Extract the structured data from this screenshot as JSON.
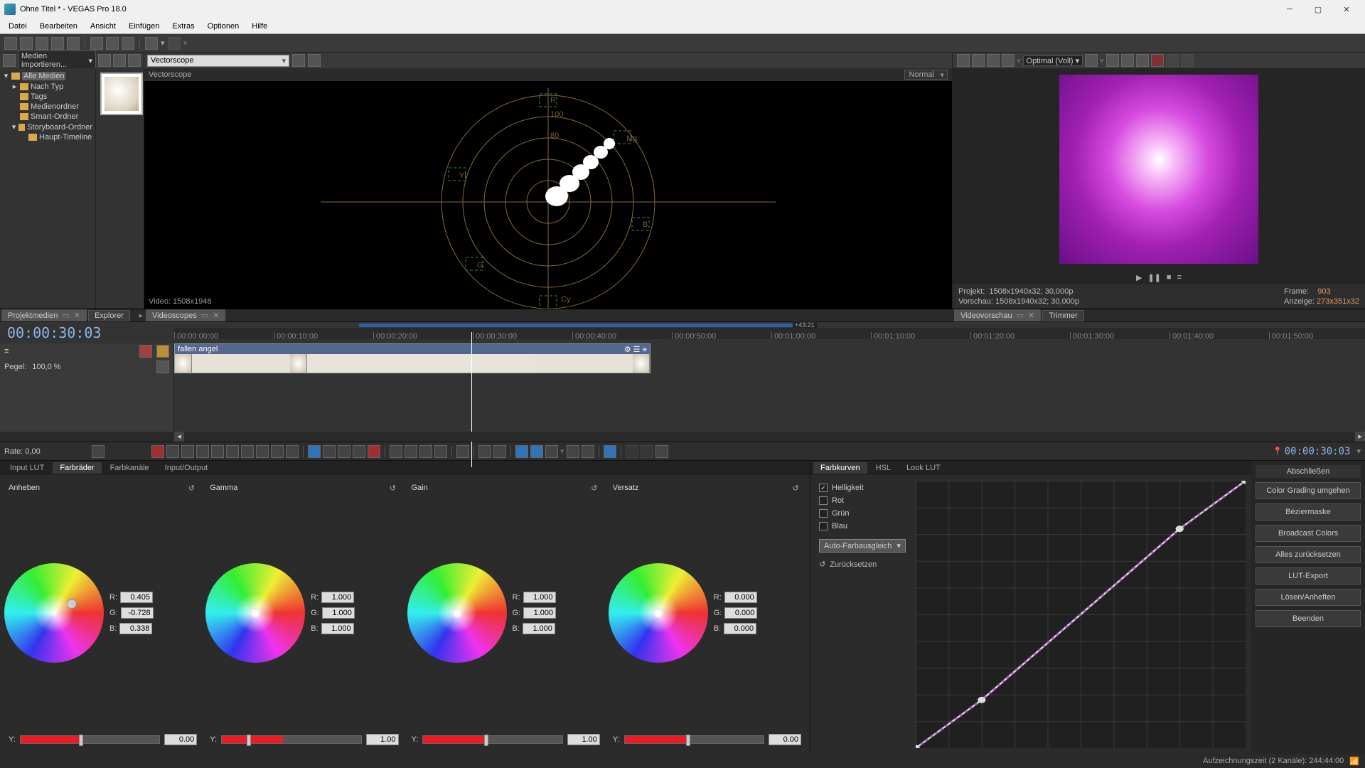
{
  "window": {
    "title": "Ohne Titel * - VEGAS Pro 18.0"
  },
  "menu": [
    "Datei",
    "Bearbeiten",
    "Ansicht",
    "Einfügen",
    "Extras",
    "Optionen",
    "Hilfe"
  ],
  "media_panel": {
    "import": "Medien importieren...",
    "tree": {
      "root": "Alle Medien",
      "items": [
        "Nach Typ",
        "Tags",
        "Medienordner",
        "Smart-Ordner",
        "Storyboard-Ordner",
        "Haupt-Timeline"
      ]
    },
    "tabs": {
      "project": "Projektmedien",
      "explorer": "Explorer"
    }
  },
  "scope": {
    "type": "Vectorscope",
    "label": "Vectorscope",
    "mode": "Normal",
    "video_res": "Video: 1508x1948",
    "tab": "Videoscopes"
  },
  "preview": {
    "quality": "Optimal (Voll)",
    "projekt_label": "Projekt:",
    "projekt_val": "1508x1940x32; 30,000p",
    "vorschau_label": "Vorschau:",
    "vorschau_val": "1508x1940x32; 30,000p",
    "frame_label": "Frame:",
    "frame_val": "903",
    "anzeige_label": "Anzeige:",
    "anzeige_val": "273x351x32",
    "tabs": {
      "vp": "Videovorschau",
      "tr": "Trimmer"
    }
  },
  "timeline": {
    "tc": "00:00:30:03",
    "loop_end": "+43:21",
    "ticks": [
      "00:00:00:00",
      "00:00:10:00",
      "00:00:20:00",
      "00:00:30:00",
      "00:00:40:00",
      "00:00:50:00",
      "00:01:00:00",
      "00:01:10:00",
      "00:01:20:00",
      "00:01:30:00",
      "00:01:40:00",
      "00:01:50:00"
    ],
    "pegel_label": "Pegel:",
    "pegel_val": "100,0 %",
    "clip_name": "fallen angel"
  },
  "transport": {
    "rate": "Rate: 0,00",
    "tc": "00:00:30:03"
  },
  "color": {
    "tabs_left": [
      "Input LUT",
      "Farbräder",
      "Farbkanäle",
      "Input/Output"
    ],
    "tabs_right": [
      "Farbkurven",
      "HSL",
      "Look LUT"
    ],
    "wheels": [
      {
        "name": "Anheben",
        "r": "0.405",
        "g": "-0.728",
        "b": "0.338",
        "y": "0.00",
        "dot": [
          0.68,
          0.41
        ],
        "thumb": 42
      },
      {
        "name": "Gamma",
        "r": "1.000",
        "g": "1.000",
        "b": "1.000",
        "y": "1.00",
        "dot": [
          0.5,
          0.5
        ],
        "thumb": 18
      },
      {
        "name": "Gain",
        "r": "1.000",
        "g": "1.000",
        "b": "1.000",
        "y": "1.00",
        "dot": [
          0.5,
          0.5
        ],
        "thumb": 44
      },
      {
        "name": "Versatz",
        "r": "0.000",
        "g": "0.000",
        "b": "0.000",
        "y": "0.00",
        "dot": [
          0.5,
          0.5
        ],
        "thumb": 44
      }
    ],
    "curves": {
      "channels": [
        {
          "key": "helligkeit",
          "label": "Helligkeit",
          "checked": true
        },
        {
          "key": "rot",
          "label": "Rot",
          "checked": false
        },
        {
          "key": "gruen",
          "label": "Grün",
          "checked": false
        },
        {
          "key": "blau",
          "label": "Blau",
          "checked": false
        }
      ],
      "auto": "Auto-Farbausgleich",
      "reset": "Zurücksetzen"
    },
    "right_header": "Abschließen",
    "right_buttons": [
      "Color Grading umgehen",
      "Bézier­maske",
      "Broadcast Colors",
      "Alles zurücksetzen",
      "LUT-Export",
      "Lösen/Anheften",
      "Beenden"
    ]
  },
  "status": {
    "rec": "Aufzeichnungszeit (2 Kanäle): 244:44:00"
  },
  "labels": {
    "R": "R:",
    "G": "G:",
    "B": "B:",
    "Y": "Y:"
  }
}
